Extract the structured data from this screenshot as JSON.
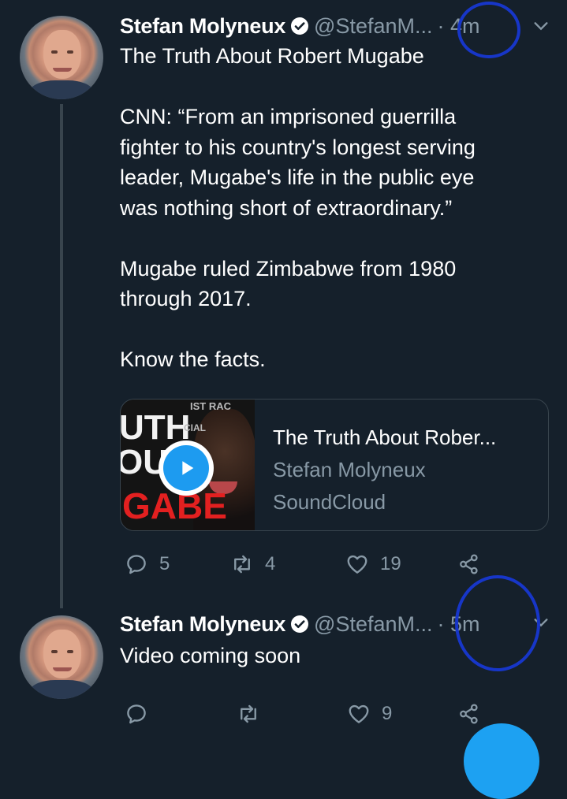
{
  "tweets": [
    {
      "author_name": "Stefan Molyneux",
      "handle": "@StefanM...",
      "time": "· 4m",
      "lines": [
        "The Truth About Robert Mugabe",
        "",
        "CNN: “From an imprisoned guerrilla",
        "fighter to his country's longest serving",
        "leader, Mugabe's life in the public eye",
        "was nothing short of extraordinary.”",
        "",
        "Mugabe ruled Zimbabwe from 1980",
        "through 2017.",
        "",
        "Know the facts."
      ],
      "card": {
        "title": "The Truth About Rober...",
        "author": "Stefan Molyneux",
        "source": "SoundCloud",
        "thumb_text": [
          "UTH",
          "OU",
          "GABE",
          "IST RAC",
          "CIAL"
        ]
      },
      "actions": {
        "replies": "5",
        "retweets": "4",
        "likes": "19"
      }
    },
    {
      "author_name": "Stefan Molyneux",
      "handle": "@StefanM...",
      "time": "· 5m",
      "lines": [
        "Video coming soon"
      ],
      "actions": {
        "replies": "",
        "retweets": "",
        "likes": "9"
      }
    }
  ],
  "icons": {
    "verified": "verified-badge-icon",
    "menu": "chevron-down-icon",
    "reply": "reply-icon",
    "retweet": "retweet-icon",
    "like": "heart-icon",
    "share": "share-icon",
    "play": "play-icon"
  },
  "colors": {
    "background": "#15202b",
    "secondary_text": "#8899a6",
    "accent": "#1da1f2",
    "annotation": "#1736c8"
  }
}
